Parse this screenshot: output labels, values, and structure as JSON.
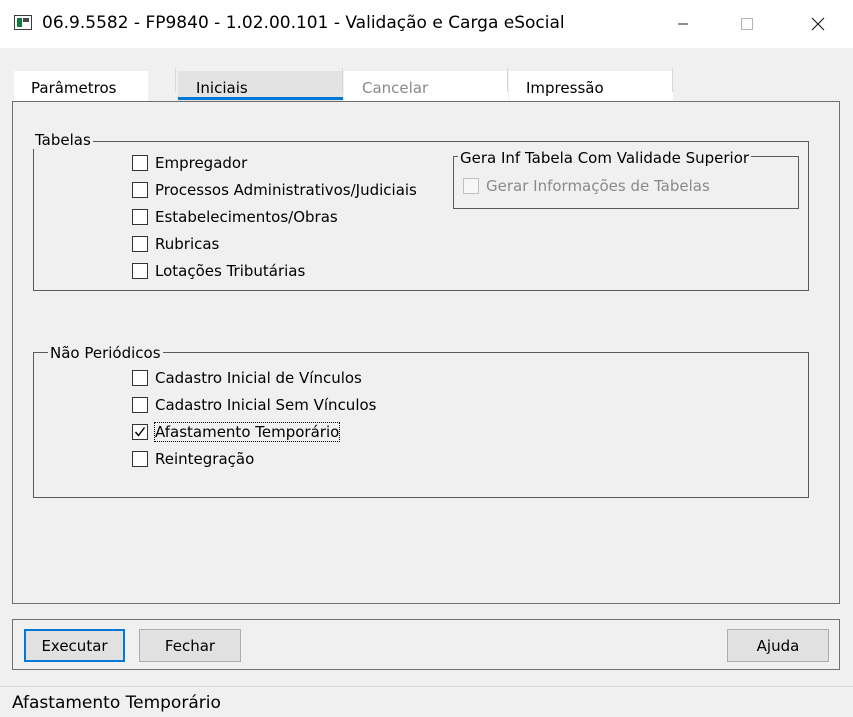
{
  "window": {
    "title": "06.9.5582 - FP9840 - 1.02.00.101 - Validação e Carga eSocial",
    "minimize_glyph": "—",
    "maximize_glyph": "☐",
    "close_glyph": "✕"
  },
  "tabs": [
    {
      "label": "Parâmetros",
      "state": "normal"
    },
    {
      "label": "Iniciais",
      "state": "selected"
    },
    {
      "label": "Cancelar",
      "state": "disabled"
    },
    {
      "label": "Impressão",
      "state": "normal"
    }
  ],
  "tabelas": {
    "legend": "Tabelas",
    "items": [
      {
        "label": "Empregador",
        "checked": false
      },
      {
        "label": "Processos Administrativos/Judiciais",
        "checked": false
      },
      {
        "label": "Estabelecimentos/Obras",
        "checked": false
      },
      {
        "label": "Rubricas",
        "checked": false
      },
      {
        "label": "Lotações Tributárias",
        "checked": false
      }
    ]
  },
  "gera_inf": {
    "legend": "Gera Inf Tabela Com Validade Superior",
    "item": {
      "label": "Gerar Informações de Tabelas",
      "checked": false,
      "enabled": false
    }
  },
  "nao_periodicos": {
    "legend": "Não Periódicos",
    "items": [
      {
        "label": "Cadastro Inicial de Vínculos",
        "checked": false
      },
      {
        "label": "Cadastro Inicial Sem Vínculos",
        "checked": false
      },
      {
        "label": "Afastamento Temporário",
        "checked": true,
        "focused": true
      },
      {
        "label": "Reintegração",
        "checked": false
      }
    ]
  },
  "buttons": {
    "executar": "Executar",
    "fechar": "Fechar",
    "ajuda": "Ajuda"
  },
  "status": {
    "text": "Afastamento Temporário"
  },
  "colors": {
    "tab_selected_underline": "#0078d7",
    "check_mark": "#000000",
    "default_button_border": "#0078d7"
  }
}
